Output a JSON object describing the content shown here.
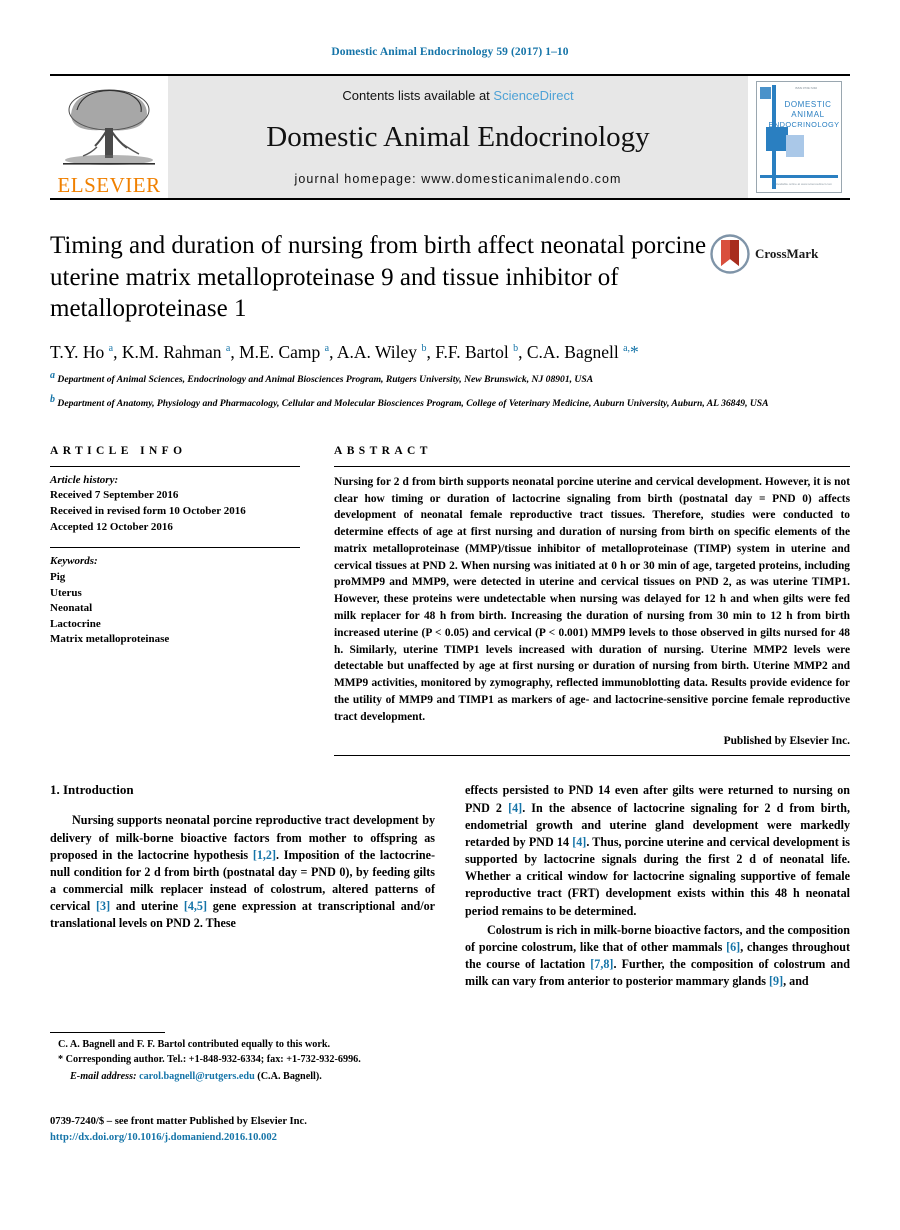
{
  "running_head": "Domestic Animal Endocrinology 59 (2017) 1–10",
  "masthead": {
    "publisher_name": "ELSEVIER",
    "contents_prefix": "Contents lists available at ",
    "contents_link": "ScienceDirect",
    "journal_title": "Domestic Animal Endocrinology",
    "homepage": "journal homepage: www.domesticanimalendo.com",
    "cover": {
      "line1": "DOMESTIC",
      "line2": "ANIMAL",
      "line3": "ENDOCRINOLOGY",
      "corner_text": "ISSN 0739-7240",
      "footer_text": "Available online at www.sciencedirect.com"
    }
  },
  "article": {
    "title": "Timing and duration of nursing from birth affect neonatal porcine uterine matrix metalloproteinase 9 and tissue inhibitor of metalloproteinase 1",
    "crossmark_label": "CrossMark",
    "authors_html": "T.Y. Ho <sup>a</sup>, K.M. Rahman <sup>a</sup>, M.E. Camp <sup>a</sup>, A.A. Wiley <sup>b</sup>, F.F. Bartol <sup>b</sup>, C.A. Bagnell <sup>a,</sup><span class=\"star\">*</span>",
    "affiliations": [
      "Department of Animal Sciences, Endocrinology and Animal Biosciences Program, Rutgers University, New Brunswick, NJ 08901, USA",
      "Department of Anatomy, Physiology and Pharmacology, Cellular and Molecular Biosciences Program, College of Veterinary Medicine, Auburn University, Auburn, AL 36849, USA"
    ]
  },
  "article_info": {
    "heading": "ARTICLE INFO",
    "history_label": "Article history:",
    "history": [
      "Received 7 September 2016",
      "Received in revised form 10 October 2016",
      "Accepted 12 October 2016"
    ],
    "keywords_label": "Keywords:",
    "keywords": [
      "Pig",
      "Uterus",
      "Neonatal",
      "Lactocrine",
      "Matrix metalloproteinase"
    ]
  },
  "abstract": {
    "heading": "ABSTRACT",
    "text": "Nursing for 2 d from birth supports neonatal porcine uterine and cervical development. However, it is not clear how timing or duration of lactocrine signaling from birth (postnatal day = PND 0) affects development of neonatal female reproductive tract tissues. Therefore, studies were conducted to determine effects of age at first nursing and duration of nursing from birth on specific elements of the matrix metalloproteinase (MMP)/tissue inhibitor of metalloproteinase (TIMP) system in uterine and cervical tissues at PND 2. When nursing was initiated at 0 h or 30 min of age, targeted proteins, including proMMP9 and MMP9, were detected in uterine and cervical tissues on PND 2, as was uterine TIMP1. However, these proteins were undetectable when nursing was delayed for 12 h and when gilts were fed milk replacer for 48 h from birth. Increasing the duration of nursing from 30 min to 12 h from birth increased uterine (P < 0.05) and cervical (P < 0.001) MMP9 levels to those observed in gilts nursed for 48 h. Similarly, uterine TIMP1 levels increased with duration of nursing. Uterine MMP2 levels were detectable but unaffected by age at first nursing or duration of nursing from birth. Uterine MMP2 and MMP9 activities, monitored by zymography, reflected immunoblotting data. Results provide evidence for the utility of MMP9 and TIMP1 as markers of age- and lactocrine-sensitive porcine female reproductive tract development.",
    "publisher_line": "Published by Elsevier Inc."
  },
  "body": {
    "section_number_title": "1. Introduction",
    "left_paragraph_html": "Nursing supports neonatal porcine reproductive tract development by delivery of milk-borne bioactive factors from mother to offspring as proposed in the lactocrine hypothesis <span class=\"ref\">[1,2]</span>. Imposition of the lactocrine-null condition for 2 d from birth (postnatal day = PND 0), by feeding gilts a commercial milk replacer instead of colostrum, altered patterns of cervical <span class=\"ref\">[3]</span> and uterine <span class=\"ref\">[4,5]</span> gene expression at transcriptional and/or translational levels on PND 2. These",
    "right_paragraph1_html": "effects persisted to PND 14 even after gilts were returned to nursing on PND 2 <span class=\"ref\">[4]</span>. In the absence of lactocrine signaling for 2 d from birth, endometrial growth and uterine gland development were markedly retarded by PND 14 <span class=\"ref\">[4]</span>. Thus, porcine uterine and cervical development is supported by lactocrine signals during the first 2 d of neonatal life. Whether a critical window for lactocrine signaling supportive of female reproductive tract (FRT) development exists within this 48 h neonatal period remains to be determined.",
    "right_paragraph2_html": "Colostrum is rich in milk-borne bioactive factors, and the composition of porcine colostrum, like that of other mammals <span class=\"ref\">[6]</span>, changes throughout the course of lactation <span class=\"ref\">[7,8]</span>. Further, the composition of colostrum and milk can vary from anterior to posterior mammary glands <span class=\"ref\">[9]</span>, and"
  },
  "footnotes": {
    "equal_contribution": "C. A. Bagnell and F. F. Bartol contributed equally to this work.",
    "corresponding_html": "* Corresponding author. Tel.: +1-848-932-6334; fax: +1-732-932-6996.",
    "email_label": "E-mail address:",
    "email": "carol.bagnell@rutgers.edu",
    "email_owner": "(C.A. Bagnell).",
    "imprint": "0739-7240/$ – see front matter Published by Elsevier Inc.",
    "doi": "http://dx.doi.org/10.1016/j.domaniend.2016.10.002"
  },
  "colors": {
    "link_blue": "#1574a8",
    "sciencedirect_blue": "#4ea2d6",
    "elsevier_orange": "#f08000",
    "band_gray": "#e7e7e7",
    "cover_blue": "#2a7fc1"
  }
}
